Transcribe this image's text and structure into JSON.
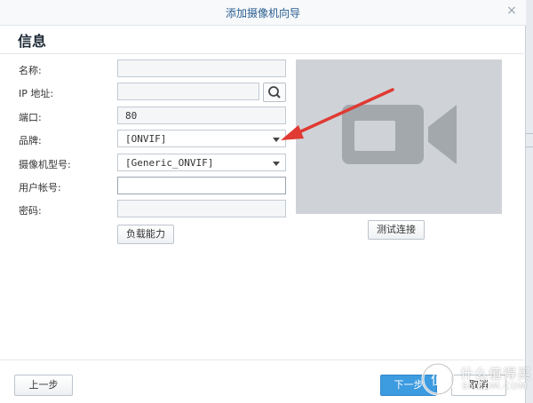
{
  "dialog": {
    "title": "添加摄像机向导",
    "close": "×",
    "section_title": "信息"
  },
  "form": {
    "name_label": "名称:",
    "name_value": "",
    "ip_label": "IP 地址:",
    "ip_value": "",
    "port_label": "端口:",
    "port_value": "80",
    "brand_label": "品牌:",
    "brand_value": "[ONVIF]",
    "model_label": "摄像机型号:",
    "model_value": "[Generic_ONVIF]",
    "user_label": "用户帐号:",
    "user_value": "",
    "password_label": "密码:",
    "password_value": "",
    "load_capability_button": "负载能力"
  },
  "preview": {
    "camera_icon": "video-camera-icon",
    "test_connection_button": "测试连接"
  },
  "footer": {
    "prev_button": "上一步",
    "next_button": "下一步",
    "cancel_button": "取消"
  },
  "watermark": {
    "text": "什么值得买",
    "sub": "SMZDM.COM"
  },
  "colors": {
    "accent": "#3d9be0",
    "arrow": "#e03a33",
    "preview_bg": "#cfd3d7"
  }
}
